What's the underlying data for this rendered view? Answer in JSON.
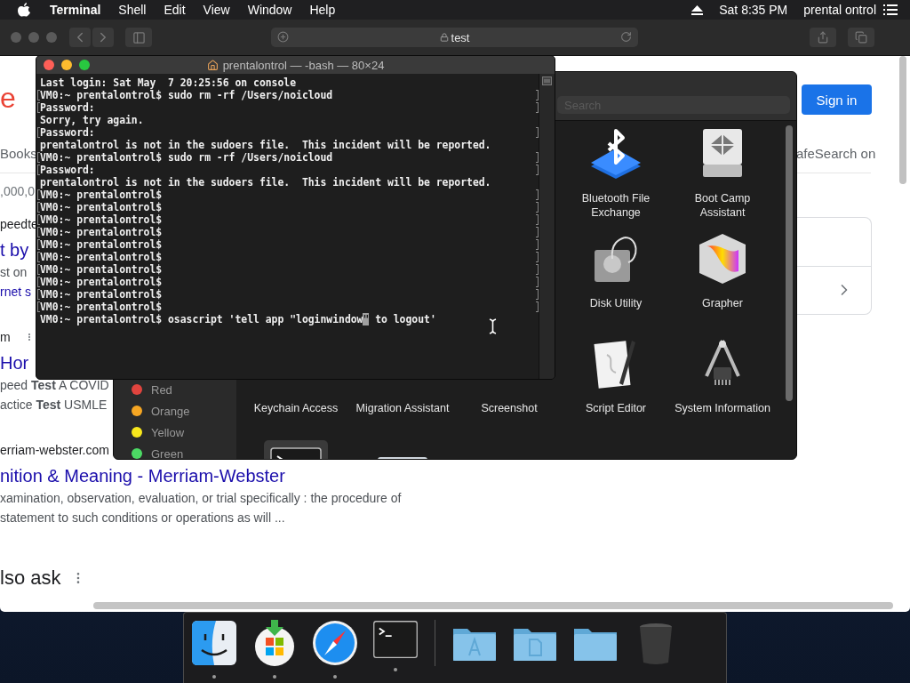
{
  "menu_bar": {
    "app": "Terminal",
    "menus": [
      "Shell",
      "Edit",
      "View",
      "Window",
      "Help"
    ],
    "clock": "Sat 8:35 PM",
    "user": "prental ontrol"
  },
  "browser": {
    "address": "test",
    "header": {
      "logo_fragment": "e",
      "sign_in": "Sign in"
    },
    "nav": {
      "tab": "Books",
      "safesearch": "afeSearch on"
    },
    "result_stats": ",000,0",
    "results": [
      {
        "url": "peedte",
        "title": "t by",
        "snippet": [
          "st on"
        ],
        "link": "rnet s"
      },
      {
        "url": "m",
        "title": "Hor",
        "snippet": [
          "peed **Test** A COVID",
          "actice **Test** USMLE"
        ],
        "menu": true
      },
      {
        "url": "erriam-webster.com",
        "title": "nition & Meaning - Merriam-Webster",
        "snippet": [
          "xamination, observation, evaluation, or trial specifically : the procedure of",
          "statement to such conditions or operations as will ..."
        ]
      }
    ],
    "section_heading": "lso ask"
  },
  "finder": {
    "search_placeholder": "Search",
    "tags": [
      {
        "label": "Red",
        "color": "#e0443e"
      },
      {
        "label": "Orange",
        "color": "#f5a623"
      },
      {
        "label": "Yellow",
        "color": "#f8e71c"
      },
      {
        "label": "Green",
        "color": "#4cd964"
      }
    ],
    "rows": [
      {
        "kind": "end",
        "items": [
          {
            "label": "Bluetooth File Exchange",
            "kind": "bluetooth",
            "selected": false
          },
          {
            "label": "Boot Camp Assistant",
            "kind": "bootcamp",
            "selected": false
          }
        ]
      },
      {
        "kind": "end",
        "items": [
          {
            "label": "Disk Utility",
            "kind": "disk",
            "selected": false
          },
          {
            "label": "Grapher",
            "kind": "grapher",
            "selected": false
          }
        ]
      },
      {
        "kind": "start",
        "items": [
          {
            "label": "Keychain Access",
            "selected": false
          },
          {
            "label": "Migration Assistant",
            "selected": false
          },
          {
            "label": "Screenshot",
            "selected": false
          },
          {
            "label": "Script Editor",
            "kind": "script",
            "selected": false
          },
          {
            "label": "System Information",
            "kind": "sysinfo",
            "selected": false
          }
        ]
      },
      {
        "kind": "start",
        "items": [
          {
            "kind": "terminal",
            "selected": true
          },
          {
            "kind": "audio",
            "selected": false
          }
        ]
      }
    ]
  },
  "terminal": {
    "title": "prentalontrol — -bash — 80×24",
    "lines": [
      {
        "text": "Last login: Sat May  7 20:25:56 on console",
        "marked": false
      },
      {
        "text": "VM0:~ prentalontrol$ sudo rm -rf /Users/noicloud",
        "marked": true
      },
      {
        "text": "Password:",
        "marked": true
      },
      {
        "text": "Sorry, try again.",
        "marked": false
      },
      {
        "text": "Password:",
        "marked": true
      },
      {
        "text": "prentalontrol is not in the sudoers file.  This incident will be reported.",
        "marked": false
      },
      {
        "text": "VM0:~ prentalontrol$ sudo rm -rf /Users/noicloud",
        "marked": true
      },
      {
        "text": "Password:",
        "marked": true
      },
      {
        "text": "prentalontrol is not in the sudoers file.  This incident will be reported.",
        "marked": false
      },
      {
        "text": "VM0:~ prentalontrol$",
        "marked": true
      },
      {
        "text": "VM0:~ prentalontrol$",
        "marked": true
      },
      {
        "text": "VM0:~ prentalontrol$",
        "marked": true
      },
      {
        "text": "VM0:~ prentalontrol$",
        "marked": true
      },
      {
        "text": "VM0:~ prentalontrol$",
        "marked": true
      },
      {
        "text": "VM0:~ prentalontrol$",
        "marked": true
      },
      {
        "text": "VM0:~ prentalontrol$",
        "marked": true
      },
      {
        "text": "VM0:~ prentalontrol$",
        "marked": true
      },
      {
        "text": "VM0:~ prentalontrol$",
        "marked": true
      },
      {
        "text": "VM0:~ prentalontrol$",
        "marked": true
      },
      {
        "text": "VM0:~ prentalontrol$ osascript 'tell app \"loginwindow",
        "cursor": "\"",
        "after": " to logout'",
        "marked": false
      }
    ]
  },
  "dock": {
    "items": [
      {
        "kind": "finder",
        "running": true
      },
      {
        "kind": "installer",
        "running": true
      },
      {
        "kind": "safari",
        "running": true
      },
      {
        "kind": "terminal",
        "running": true
      },
      {
        "kind": "separator"
      },
      {
        "kind": "apps-folder",
        "running": false
      },
      {
        "kind": "docs-folder",
        "running": false
      },
      {
        "kind": "folder",
        "running": false
      },
      {
        "kind": "trash",
        "running": false
      }
    ]
  }
}
